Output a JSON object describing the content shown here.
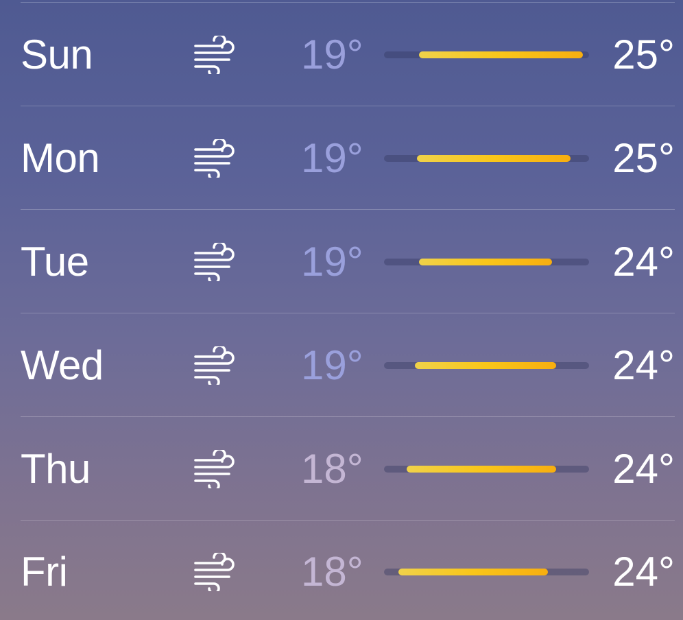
{
  "forecast": [
    {
      "day": "Sun",
      "icon": "wind-icon",
      "low": "19°",
      "high": "25°",
      "range_start": 0.17,
      "range_end": 0.97
    },
    {
      "day": "Mon",
      "icon": "wind-icon",
      "low": "19°",
      "high": "25°",
      "range_start": 0.16,
      "range_end": 0.91
    },
    {
      "day": "Tue",
      "icon": "wind-icon",
      "low": "19°",
      "high": "24°",
      "range_start": 0.17,
      "range_end": 0.82
    },
    {
      "day": "Wed",
      "icon": "wind-icon",
      "low": "19°",
      "high": "24°",
      "range_start": 0.15,
      "range_end": 0.84
    },
    {
      "day": "Thu",
      "icon": "wind-icon",
      "low": "18°",
      "high": "24°",
      "range_start": 0.11,
      "range_end": 0.84
    },
    {
      "day": "Fri",
      "icon": "wind-icon",
      "low": "18°",
      "high": "24°",
      "range_start": 0.07,
      "range_end": 0.8
    }
  ],
  "colors": {
    "low_temp": "#9aa0dc",
    "low_temp_dim": "#c4b6d4",
    "bar_start": "#f0d24a",
    "bar_end": "#f7ae10"
  }
}
